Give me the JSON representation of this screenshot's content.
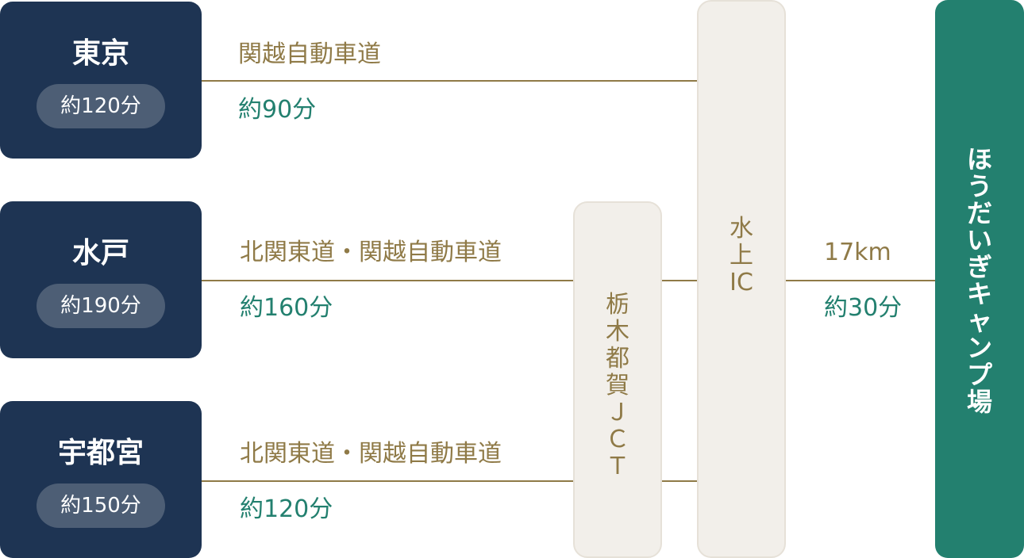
{
  "origins": [
    {
      "city": "東京",
      "time": "約120分"
    },
    {
      "city": "水戸",
      "time": "約190分"
    },
    {
      "city": "宇都宮",
      "time": "約150分"
    }
  ],
  "routes": [
    {
      "road": "関越自動車道",
      "time": "約90分"
    },
    {
      "road": "北関東道・関越自動車道",
      "time": "約160分"
    },
    {
      "road": "北関東道・関越自動車道",
      "time": "約120分"
    }
  ],
  "junction": {
    "chars": [
      "栃",
      "木",
      "都",
      "賀",
      "Ｊ",
      "Ｃ",
      "Ｔ"
    ]
  },
  "interchange": {
    "chars": [
      "水",
      "上",
      "IC"
    ]
  },
  "final_leg": {
    "distance": "17km",
    "time": "約30分"
  },
  "destination": {
    "chars": [
      "ほ",
      "う",
      "だ",
      "い",
      "ぎ",
      "キ",
      "ャ",
      "ン",
      "プ",
      "場"
    ]
  },
  "colors": {
    "origin_bg": "#1e3453",
    "pill_bg": "#4d5e75",
    "road": "#8f7a47",
    "time_text": "#23806f",
    "node_bg": "#f2efea",
    "destination_bg": "#23806f"
  }
}
